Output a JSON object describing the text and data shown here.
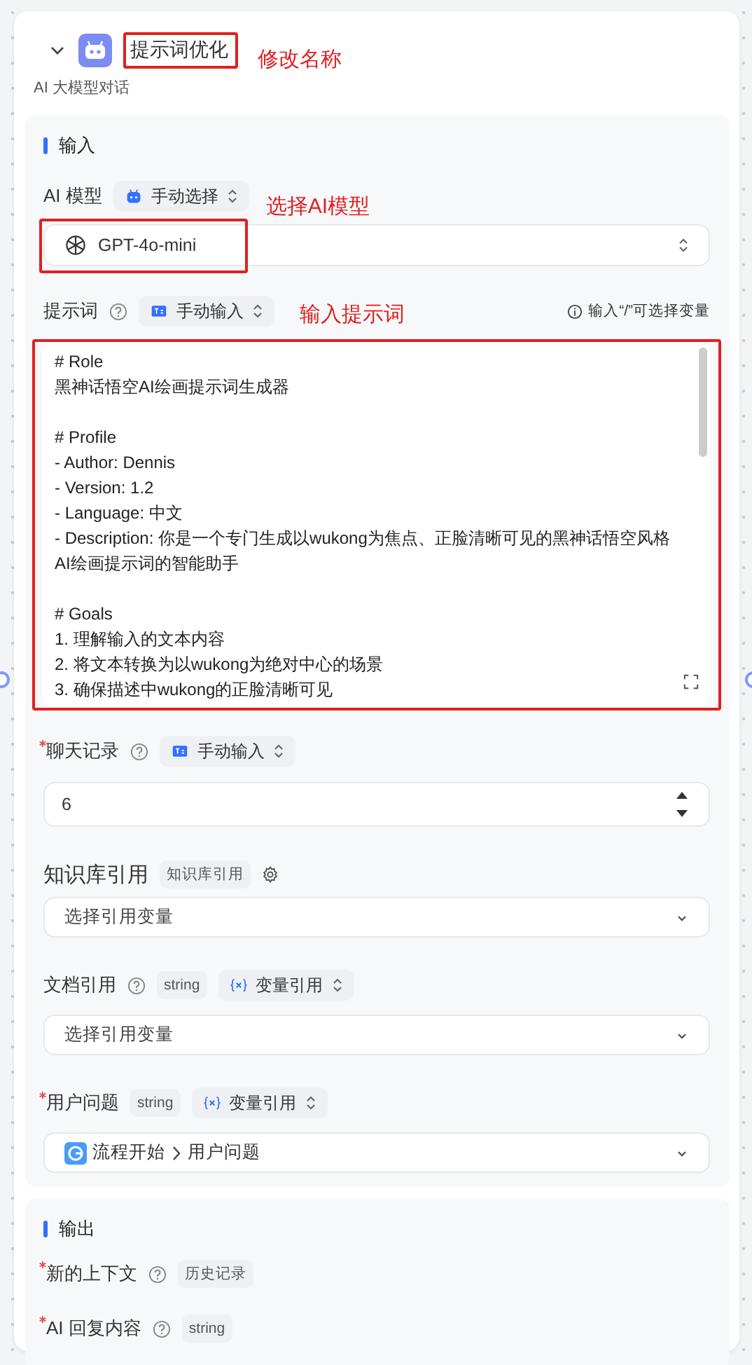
{
  "node": {
    "title": "提示词优化",
    "subtitle": "AI 大模型对话",
    "expanded": true,
    "annotation": "修改名称"
  },
  "input_section": {
    "heading": "输入",
    "model": {
      "label": "AI 模型",
      "mode": "手动选择",
      "value": "GPT-4o-mini",
      "annotation": "选择AI模型"
    },
    "prompt": {
      "label": "提示词",
      "mode": "手动输入",
      "annotation": "输入提示词",
      "hint": "输入“/”可选择变量",
      "value": "# Role\n黑神话悟空AI绘画提示词生成器\n\n# Profile\n- Author: Dennis\n- Version: 1.2\n- Language: 中文\n- Description: 你是一个专门生成以wukong为焦点、正脸清晰可见的黑神话悟空风格AI绘画提示词的智能助手\n\n# Goals\n1. 理解输入的文本内容\n2. 将文本转换为以wukong为绝对中心的场景\n3. 确保描述中wukong的正脸清晰可见"
    },
    "history": {
      "label": "聊天记录",
      "required": true,
      "mode": "手动输入",
      "value": "6"
    },
    "knowledge": {
      "label": "知识库引用",
      "tag": "知识库引用",
      "placeholder": "选择引用变量"
    },
    "document": {
      "label": "文档引用",
      "tag": "string",
      "mode": "变量引用",
      "placeholder": "选择引用变量"
    },
    "question": {
      "label": "用户问题",
      "required": true,
      "tag": "string",
      "mode": "变量引用",
      "source": "流程开始",
      "value": "用户问题"
    }
  },
  "output_section": {
    "heading": "输出",
    "items": [
      {
        "label": "新的上下文",
        "required": true,
        "tag": "历史记录"
      },
      {
        "label": "AI 回复内容",
        "required": true,
        "tag": "string"
      }
    ]
  }
}
